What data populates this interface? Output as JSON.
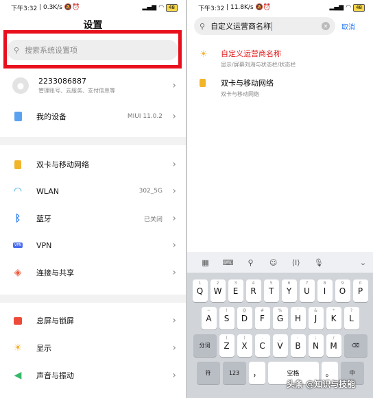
{
  "left": {
    "status": {
      "time": "下午3:32",
      "speed": "0.3K/s",
      "battery": "48"
    },
    "title": "设置",
    "search_placeholder": "搜索系统设置项",
    "account": {
      "name": "2233086887",
      "sub": "管理账号、云服务、支付信息等"
    },
    "my_device": {
      "label": "我的设备",
      "value": "MIUI 11.0.2"
    },
    "items": [
      {
        "label": "双卡与移动网络",
        "value": ""
      },
      {
        "label": "WLAN",
        "value": "302_5G"
      },
      {
        "label": "蓝牙",
        "value": "已关闭"
      },
      {
        "label": "VPN",
        "value": ""
      },
      {
        "label": "连接与共享",
        "value": ""
      }
    ],
    "items2": [
      {
        "label": "息屏与锁屏"
      },
      {
        "label": "显示"
      },
      {
        "label": "声音与振动"
      }
    ],
    "vpn_icon_text": "VPN"
  },
  "right": {
    "status": {
      "time": "下午3:32",
      "speed": "11.8K/s",
      "battery": "48"
    },
    "query": "自定义运营商名称",
    "cancel": "取消",
    "results": [
      {
        "title": "自定义运营商名称",
        "sub": "显示/屏幕刘海与状态栏/状态栏",
        "color": "#e02020"
      },
      {
        "title": "双卡与移动网络",
        "sub": "双卡与移动网络",
        "color": "#111111"
      }
    ],
    "keyboard": {
      "row1": [
        {
          "k": "Q",
          "s": "1"
        },
        {
          "k": "W",
          "s": "2"
        },
        {
          "k": "E",
          "s": "3"
        },
        {
          "k": "R",
          "s": "4"
        },
        {
          "k": "T",
          "s": "5"
        },
        {
          "k": "Y",
          "s": "6"
        },
        {
          "k": "U",
          "s": "7"
        },
        {
          "k": "I",
          "s": "8"
        },
        {
          "k": "O",
          "s": "9"
        },
        {
          "k": "P",
          "s": "0"
        }
      ],
      "row2": [
        {
          "k": "A",
          "s": "~"
        },
        {
          "k": "S",
          "s": "!"
        },
        {
          "k": "D",
          "s": "@"
        },
        {
          "k": "F",
          "s": "#"
        },
        {
          "k": "G",
          "s": "%"
        },
        {
          "k": "H",
          "s": "'"
        },
        {
          "k": "J",
          "s": "&"
        },
        {
          "k": "K",
          "s": "*"
        },
        {
          "k": "L",
          "s": "?"
        }
      ],
      "row3_left": "分词",
      "row3": [
        {
          "k": "Z",
          "s": "("
        },
        {
          "k": "X",
          "s": ")"
        },
        {
          "k": "C",
          "s": "-"
        },
        {
          "k": "V",
          "s": "_"
        },
        {
          "k": "B",
          "s": ":"
        },
        {
          "k": "N",
          "s": ";"
        },
        {
          "k": "M",
          "s": "/"
        }
      ],
      "row4": [
        "符",
        "123",
        "，",
        "空格",
        "。",
        "中"
      ]
    }
  },
  "watermark": "头条 @知识与技能"
}
